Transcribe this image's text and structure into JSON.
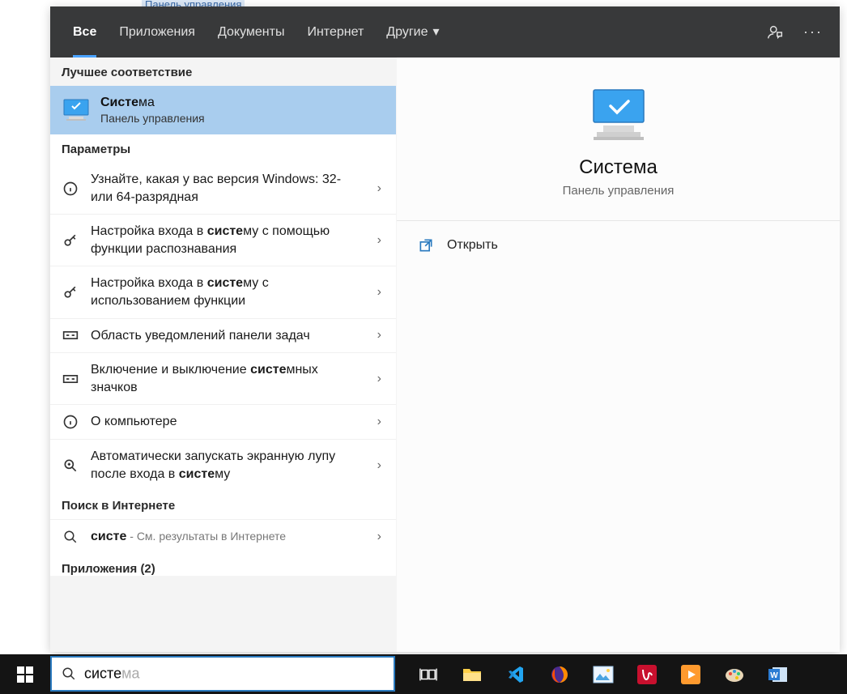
{
  "backdrop_link": "Панель управления",
  "tabs": {
    "all": "Все",
    "apps": "Приложения",
    "docs": "Документы",
    "web": "Интернет",
    "other": "Другие"
  },
  "sections": {
    "best_match": "Лучшее соответствие",
    "settings": "Параметры",
    "web_search": "Поиск в Интернете",
    "apps_count_label": "Приложения (2)"
  },
  "best_match_item": {
    "title_bold": "Систе",
    "title_rest": "ма",
    "subtitle": "Панель управления"
  },
  "settings_results": [
    {
      "icon": "info",
      "text_pre": "Узнайте, какая у вас версия Windows: 32- или 64-разрядная",
      "bold": "",
      "text_post": ""
    },
    {
      "icon": "key",
      "text_pre": "Настройка входа в ",
      "bold": "систе",
      "text_post": "му с помощью функции распознавания"
    },
    {
      "icon": "key",
      "text_pre": "Настройка входа в ",
      "bold": "систе",
      "text_post": "му с использованием функции"
    },
    {
      "icon": "tray",
      "text_pre": "Область уведомлений панели задач",
      "bold": "",
      "text_post": ""
    },
    {
      "icon": "tray",
      "text_pre": "Включение и выключение ",
      "bold": "систе",
      "text_post": "мных значков"
    },
    {
      "icon": "info",
      "text_pre": "О компьютере",
      "bold": "",
      "text_post": ""
    },
    {
      "icon": "zoom",
      "text_pre": "Автоматически запускать экранную лупу после входа в ",
      "bold": "систе",
      "text_post": "му"
    }
  ],
  "web_result": {
    "query": "систе",
    "suffix": " - См. результаты в Интернете"
  },
  "preview": {
    "title": "Система",
    "subtitle": "Панель управления",
    "open": "Открыть"
  },
  "search": {
    "typed": "систе",
    "ghost": "система"
  }
}
